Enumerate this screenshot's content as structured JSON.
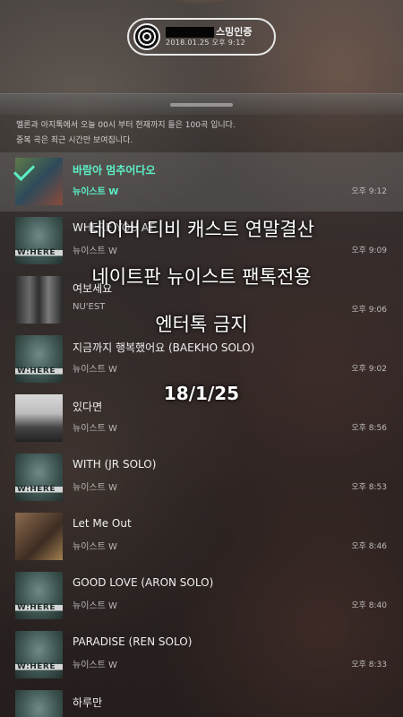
{
  "certificate": {
    "title_suffix": "스밍인증",
    "date": "2018.01.25 오후 9:12"
  },
  "notice": {
    "line1": "멜론과 아지톡에서 오늘 00시 부터 현재까지 들은 100곡 입니다.",
    "line2": "중복 곡은 최근 시간만 보여집니다."
  },
  "tracks": [
    {
      "title": "바람아 멈추어다오",
      "artist": "뉴이스트 W",
      "time": "오후 9:12",
      "active": true
    },
    {
      "title": "WHERE YOU AT",
      "artist": "뉴이스트 W",
      "time": "오후 9:09"
    },
    {
      "title": "여보세요",
      "artist": "NU'EST",
      "time": "오후 9:06"
    },
    {
      "title": "지금까지 행복했어요 (BAEKHO SOLO)",
      "artist": "뉴이스트 W",
      "time": "오후 9:02"
    },
    {
      "title": "있다면",
      "artist": "뉴이스트 W",
      "time": "오후 8:56"
    },
    {
      "title": "WITH (JR SOLO)",
      "artist": "뉴이스트 W",
      "time": "오후 8:53"
    },
    {
      "title": "Let Me Out",
      "artist": "뉴이스트 W",
      "time": "오후 8:46"
    },
    {
      "title": "GOOD LOVE (ARON SOLO)",
      "artist": "뉴이스트 W",
      "time": "오후 8:40"
    },
    {
      "title": "PARADISE (REN SOLO)",
      "artist": "뉴이스트 W",
      "time": "오후 8:33"
    },
    {
      "title": "하루만",
      "artist": "",
      "time": ""
    }
  ],
  "overlay": {
    "line1": "네이버 티비 캐스트 연말결산",
    "line2": "네이트판 뉴이스트 팬톡전용",
    "line3": "엔터톡 금지",
    "line4": "18/1/25"
  }
}
